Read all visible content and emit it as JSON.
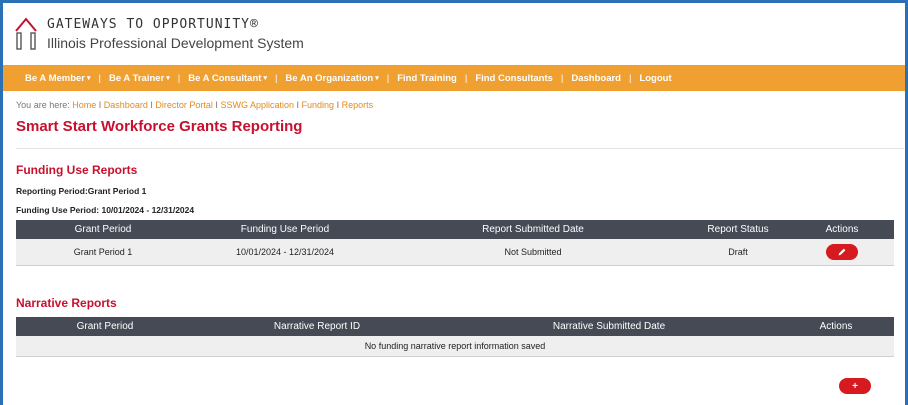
{
  "brand": {
    "title": "Gateways to Opportunity®",
    "subtitle": "Illinois Professional Development System",
    "accent_color": "#f0a030",
    "heading_color": "#c8102e"
  },
  "nav": {
    "items": [
      {
        "label": "Be A Member",
        "dropdown": true
      },
      {
        "label": "Be A Trainer",
        "dropdown": true
      },
      {
        "label": "Be A Consultant",
        "dropdown": true
      },
      {
        "label": "Be An Organization",
        "dropdown": true
      },
      {
        "label": "Find Training",
        "dropdown": false
      },
      {
        "label": "Find Consultants",
        "dropdown": false
      },
      {
        "label": "Dashboard",
        "dropdown": false
      },
      {
        "label": "Logout",
        "dropdown": false
      }
    ],
    "separator": "|",
    "caret_icon": "▾"
  },
  "breadcrumb": {
    "prefix": "You are here:",
    "links": [
      "Home",
      "Dashboard",
      "Director Portal",
      "SSWG Application",
      "Funding",
      "Reports"
    ],
    "separator": "I"
  },
  "page": {
    "title": "Smart Start Workforce Grants Reporting"
  },
  "funding": {
    "title": "Funding Use Reports",
    "reporting_period": "Reporting Period:Grant Period 1",
    "funding_use_period": "Funding Use Period: 10/01/2024 - 12/31/2024",
    "columns": [
      "Grant Period",
      "Funding Use Period",
      "Report Submitted Date",
      "Report Status",
      "Actions"
    ],
    "rows": [
      {
        "grant_period": "Grant Period 1",
        "funding_use_period": "10/01/2024 - 12/31/2024",
        "submitted_date": "Not Submitted",
        "status": "Draft",
        "action_icon": "pencil-icon"
      }
    ]
  },
  "narrative": {
    "title": "Narrative Reports",
    "columns": [
      "Grant Period",
      "Narrative Report ID",
      "Narrative Submitted Date",
      "Actions"
    ],
    "empty_message": "No funding narrative report information saved",
    "add_label": "+"
  }
}
